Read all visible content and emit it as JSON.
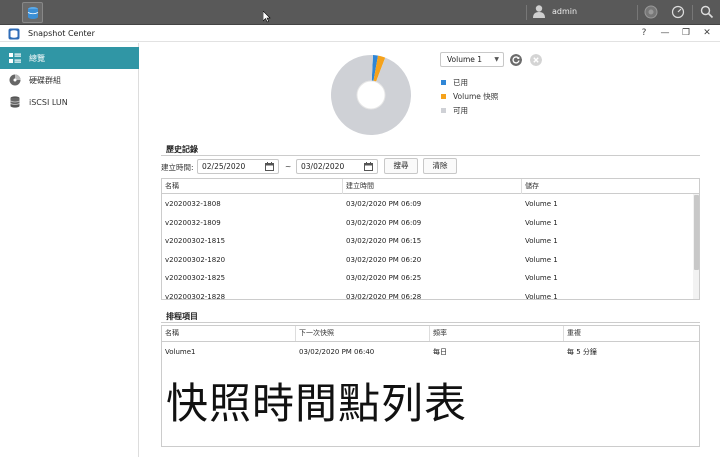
{
  "system_bar": {
    "user_name": "admin"
  },
  "window": {
    "title": "Snapshot Center",
    "help": "?",
    "minimize": "—",
    "restore": "❐",
    "close": "✕"
  },
  "sidebar": {
    "items": [
      {
        "label": "總覽",
        "icon": "overview-icon",
        "active": true
      },
      {
        "label": "硬碟群組",
        "icon": "disk-group-icon",
        "active": false
      },
      {
        "label": "iSCSI LUN",
        "icon": "iscsi-lun-icon",
        "active": false
      }
    ]
  },
  "overview": {
    "volume_select": "Volume 1",
    "usage": {
      "used_fraction": 0.02,
      "snapshot_fraction": 0.03,
      "free_fraction": 0.95
    },
    "legend": [
      {
        "label": "已用",
        "color": "#2f86d6"
      },
      {
        "label": "Volume 快照",
        "color": "#f5a21b"
      },
      {
        "label": "可用",
        "color": "#cfd1d6"
      }
    ]
  },
  "history": {
    "section_title": "歷史記錄",
    "created_label": "建立時間:",
    "date_from": "02/25/2020",
    "date_sep": "~",
    "date_to": "03/02/2020",
    "search_label": "搜尋",
    "clear_label": "清除",
    "columns": [
      "名稱",
      "建立時間",
      "儲存"
    ],
    "rows": [
      [
        "v2020032-1808",
        "03/02/2020 PM 06:09",
        "Volume 1"
      ],
      [
        "v2020032-1809",
        "03/02/2020 PM 06:09",
        "Volume 1"
      ],
      [
        "v20200302-1815",
        "03/02/2020 PM 06:15",
        "Volume 1"
      ],
      [
        "v20200302-1820",
        "03/02/2020 PM 06:20",
        "Volume 1"
      ],
      [
        "v20200302-1825",
        "03/02/2020 PM 06:25",
        "Volume 1"
      ],
      [
        "v20200302-1828",
        "03/02/2020 PM 06:28",
        "Volume 1"
      ]
    ]
  },
  "schedule": {
    "section_title": "排程項目",
    "columns": [
      "名稱",
      "下一次快照",
      "頻率",
      "重複"
    ],
    "rows": [
      [
        "Volume1",
        "03/02/2020 PM 06:40",
        "每日",
        "每 5 分鐘"
      ]
    ]
  },
  "caption": "快照時間點列表",
  "colors": {
    "accent": "#3096a5",
    "system_bar": "#595959"
  }
}
